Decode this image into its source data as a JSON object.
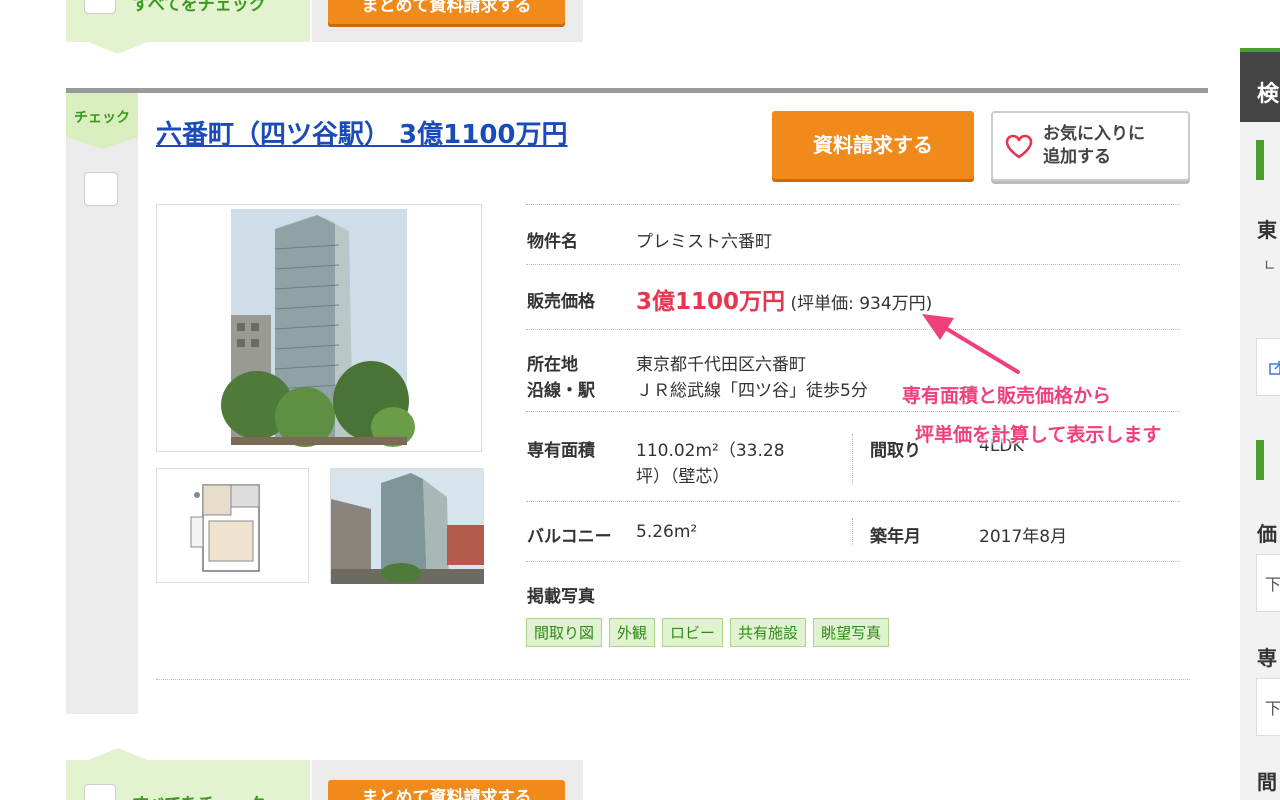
{
  "bulk_top": {
    "check_all_label": "すべてをチェック",
    "bulk_request_label": "まとめて資料請求する"
  },
  "bulk_bottom": {
    "check_all_label": "すべてをチェック",
    "bulk_request_label": "まとめて資料請求する"
  },
  "listing": {
    "check_tab_label": "チェック",
    "title": "六番町（四ツ谷駅） 3億1100万円",
    "request_button_label": "資料請求する",
    "favorite_button_label_line1": "お気に入りに",
    "favorite_button_label_line2": "追加する",
    "details": {
      "name_label": "物件名",
      "name_value": "プレミスト六番町",
      "price_label": "販売価格",
      "price_value": "3億1100万円",
      "price_per_tsubo": "(坪単価: 934万円)",
      "address_label": "所在地",
      "address_value": "東京都千代田区六番町",
      "line_label": "沿線・駅",
      "line_value": "ＪＲ総武線「四ツ谷」徒歩5分",
      "area_label": "専有面積",
      "area_value_line1": "110.02m²（33.28",
      "area_value_line2": "坪）（壁芯）",
      "layout_label": "間取り",
      "layout_value": "4LDK",
      "balcony_label": "バルコニー",
      "balcony_value": "5.26m²",
      "built_label": "築年月",
      "built_value": "2017年8月"
    },
    "photos_label": "掲載写真",
    "photo_tags": [
      "間取り図",
      "外観",
      "ロビー",
      "共有施設",
      "眺望写真"
    ]
  },
  "annotation": {
    "line1": "専有面積と販売価格から",
    "line2": "坪単価を計算して表示します",
    "color": "#f0407a"
  },
  "sidebar": {
    "head": "検",
    "item1": "東",
    "item1_sub": "∟",
    "item2": "価",
    "item2_box": "下",
    "item3": "専",
    "item3_box": "下",
    "item4": "間"
  },
  "colors": {
    "accent_orange": "#f08a1a",
    "green": "#48a02a",
    "price_red": "#e8354f",
    "title_blue": "#1a4bb8"
  }
}
